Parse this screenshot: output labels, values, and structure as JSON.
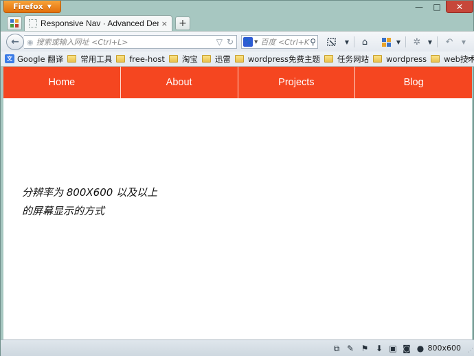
{
  "browser": {
    "menu_button": "Firefox",
    "window_controls": {
      "minimize": "—",
      "maximize": "□",
      "close": "✕"
    },
    "tab": {
      "title": "Responsive Nav · Advanced Demo",
      "close": "×"
    },
    "new_tab": "+",
    "url_bar": {
      "placeholder": "搜索或输入网址 <Ctrl+L>"
    },
    "search_bar": {
      "placeholder": "百度 <Ctrl+K>"
    },
    "bookmarks": [
      {
        "label": "Google 翻译",
        "icon": "translate-icon"
      },
      {
        "label": "常用工具",
        "icon": "folder-icon"
      },
      {
        "label": "free-host",
        "icon": "folder-icon"
      },
      {
        "label": "淘宝",
        "icon": "folder-icon"
      },
      {
        "label": "迅雷",
        "icon": "folder-icon"
      },
      {
        "label": "wordpress免费主题",
        "icon": "folder-icon"
      },
      {
        "label": "任务网站",
        "icon": "folder-icon"
      },
      {
        "label": "wordpress",
        "icon": "folder-icon"
      },
      {
        "label": "web技术",
        "icon": "folder-icon"
      }
    ],
    "bookmarks_overflow": "»",
    "status": {
      "resolution": "800x600"
    }
  },
  "page": {
    "nav": [
      "Home",
      "About",
      "Projects",
      "Blog"
    ],
    "text": "分辨率为 800X600 以及以上的屏幕显示的方式",
    "accent_color": "#f54620"
  }
}
